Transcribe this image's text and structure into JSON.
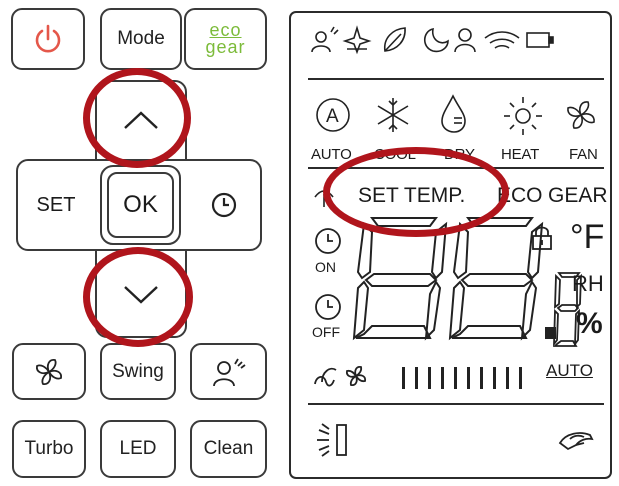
{
  "remote": {
    "power_icon": "power-icon",
    "mode_label": "Mode",
    "eco_gear_top": "eco",
    "eco_gear_bottom": "gear",
    "set_label": "SET",
    "ok_label": "OK",
    "timer_icon": "clock-icon",
    "fan_icon": "fan-icon",
    "swing_label": "Swing",
    "follow_me_icon": "person-sensor-icon",
    "turbo_label": "Turbo",
    "led_label": "LED",
    "clean_label": "Clean"
  },
  "display": {
    "modes": [
      "AUTO",
      "COOL",
      "DRY",
      "HEAT",
      "FAN"
    ],
    "set_temp_label": "SET TEMP.",
    "eco_label": "ECO",
    "gear_label": "GEAR",
    "on_label": "ON",
    "off_label": "OFF",
    "fahrenheit_label": "°F",
    "rh_label": "RH",
    "percent_label": "%",
    "fan_speed_auto_label": "AUTO"
  },
  "colors": {
    "power_red": "#e4574a",
    "eco_green": "#7cbb3a",
    "highlight_ring": "#b0151c"
  }
}
